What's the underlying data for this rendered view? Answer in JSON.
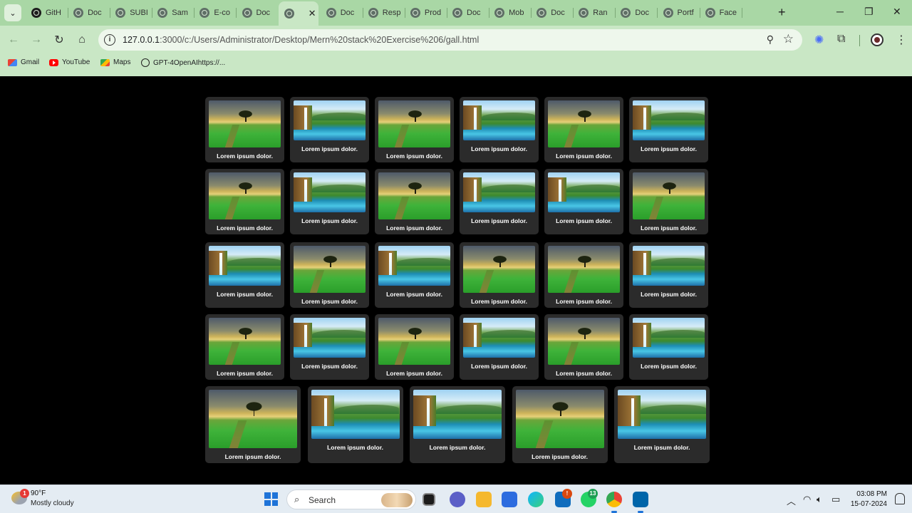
{
  "browser": {
    "tabs": [
      {
        "label": "GitH",
        "icon": "github-icon"
      },
      {
        "label": "Doc",
        "icon": "globe-icon"
      },
      {
        "label": "SUBI",
        "icon": "globe-icon"
      },
      {
        "label": "Sam",
        "icon": "globe-icon"
      },
      {
        "label": "E-co",
        "icon": "globe-icon"
      },
      {
        "label": "Doc",
        "icon": "globe-icon"
      },
      {
        "label": "",
        "icon": "globe-icon",
        "active": true
      },
      {
        "label": "Doc",
        "icon": "globe-icon"
      },
      {
        "label": "Resp",
        "icon": "globe-icon"
      },
      {
        "label": "Prod",
        "icon": "globe-icon"
      },
      {
        "label": "Doc",
        "icon": "globe-icon"
      },
      {
        "label": "Mob",
        "icon": "globe-icon"
      },
      {
        "label": "Doc",
        "icon": "globe-icon"
      },
      {
        "label": "Ran",
        "icon": "globe-icon"
      },
      {
        "label": "Doc",
        "icon": "globe-icon"
      },
      {
        "label": "Portf",
        "icon": "globe-icon"
      },
      {
        "label": "Face",
        "icon": "globe-icon"
      }
    ],
    "url_host": "127.0.0.1",
    "url_rest": ":3000/c:/Users/Administrator/Desktop/Mern%20stack%20Exercise%206/gall.html",
    "bookmarks": [
      {
        "label": "Gmail",
        "icon": "gmail-icon"
      },
      {
        "label": "YouTube",
        "icon": "youtube-icon"
      },
      {
        "label": "Maps",
        "icon": "maps-icon"
      },
      {
        "label": "GPT-4OpenAIhttps://...",
        "icon": "openai-icon"
      }
    ],
    "colors": {
      "chrome": "#c9e7c5",
      "tabstrip": "#a9d7a5"
    }
  },
  "gallery": {
    "rows": [
      [
        "tree",
        "fall",
        "tree",
        "fall",
        "tree",
        "fall"
      ],
      [
        "tree",
        "fall",
        "tree",
        "fall",
        "fall",
        "tree"
      ],
      [
        "fall",
        "tree",
        "fall",
        "tree",
        "tree",
        "fall"
      ],
      [
        "tree",
        "fall",
        "tree",
        "fall",
        "tree",
        "fall"
      ],
      [
        "tree",
        "fall",
        "fall",
        "tree",
        "fall"
      ]
    ],
    "caption": "Lorem ipsum dolor.",
    "scene_names": {
      "tree": "Tree in green field",
      "fall": "Waterfall landscape"
    },
    "colors": {
      "background": "#000000",
      "card": "#2b2b2b",
      "caption": "#ffffff"
    }
  },
  "taskbar": {
    "weather_temp": "90°F",
    "weather_desc": "Mostly cloudy",
    "weather_badge": "1",
    "search_placeholder": "Search",
    "whatsapp_badge": "13",
    "outlook_badge": "!",
    "time": "03:08 PM",
    "date": "15-07-2024"
  }
}
